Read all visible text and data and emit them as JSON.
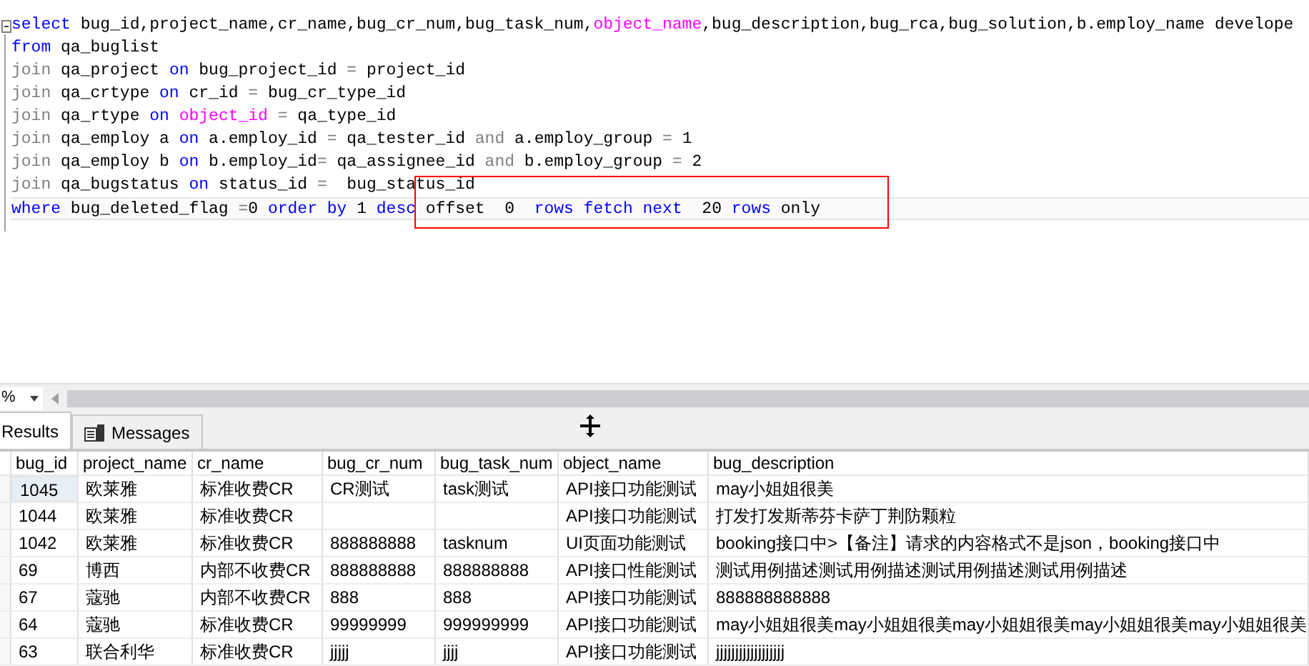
{
  "editor": {
    "lines": [
      {
        "current": false,
        "segments": [
          {
            "kind": "kw",
            "text": "select"
          },
          {
            "kind": "plain",
            "text": " bug_id,project_name,cr_name,bug_cr_num,bug_task_num,"
          },
          {
            "kind": "fn",
            "text": "object_name"
          },
          {
            "kind": "plain",
            "text": ",bug_description,bug_rca,bug_solution,b.employ_name develope"
          }
        ]
      },
      {
        "current": false,
        "segments": [
          {
            "kind": "kw",
            "text": "from"
          },
          {
            "kind": "plain",
            "text": " qa_buglist"
          }
        ]
      },
      {
        "current": false,
        "segments": [
          {
            "kind": "op",
            "text": "join"
          },
          {
            "kind": "plain",
            "text": " qa_project "
          },
          {
            "kind": "kw",
            "text": "on"
          },
          {
            "kind": "plain",
            "text": " bug_project_id "
          },
          {
            "kind": "op",
            "text": "="
          },
          {
            "kind": "plain",
            "text": " project_id"
          }
        ]
      },
      {
        "current": false,
        "segments": [
          {
            "kind": "op",
            "text": "join"
          },
          {
            "kind": "plain",
            "text": " qa_crtype "
          },
          {
            "kind": "kw",
            "text": "on"
          },
          {
            "kind": "plain",
            "text": " cr_id "
          },
          {
            "kind": "op",
            "text": "="
          },
          {
            "kind": "plain",
            "text": " bug_cr_type_id"
          }
        ]
      },
      {
        "current": false,
        "segments": [
          {
            "kind": "op",
            "text": "join"
          },
          {
            "kind": "plain",
            "text": " qa_rtype "
          },
          {
            "kind": "kw",
            "text": "on"
          },
          {
            "kind": "fn",
            "text": " object_id"
          },
          {
            "kind": "op",
            "text": " ="
          },
          {
            "kind": "plain",
            "text": " qa_type_id"
          }
        ]
      },
      {
        "current": false,
        "segments": [
          {
            "kind": "op",
            "text": "join"
          },
          {
            "kind": "plain",
            "text": " qa_employ a "
          },
          {
            "kind": "kw",
            "text": "on"
          },
          {
            "kind": "plain",
            "text": " a.employ_id "
          },
          {
            "kind": "op",
            "text": "="
          },
          {
            "kind": "plain",
            "text": " qa_tester_id "
          },
          {
            "kind": "op",
            "text": "and"
          },
          {
            "kind": "plain",
            "text": " a.employ_group "
          },
          {
            "kind": "op",
            "text": "="
          },
          {
            "kind": "plain",
            "text": " 1"
          }
        ]
      },
      {
        "current": false,
        "segments": [
          {
            "kind": "op",
            "text": "join"
          },
          {
            "kind": "plain",
            "text": " qa_employ b "
          },
          {
            "kind": "kw",
            "text": "on"
          },
          {
            "kind": "plain",
            "text": " b.employ_id"
          },
          {
            "kind": "op",
            "text": "="
          },
          {
            "kind": "plain",
            "text": " qa_assignee_id "
          },
          {
            "kind": "op",
            "text": "and"
          },
          {
            "kind": "plain",
            "text": " b.employ_group "
          },
          {
            "kind": "op",
            "text": "="
          },
          {
            "kind": "plain",
            "text": " 2"
          }
        ]
      },
      {
        "current": false,
        "segments": [
          {
            "kind": "op",
            "text": "join"
          },
          {
            "kind": "plain",
            "text": " qa_bugstatus "
          },
          {
            "kind": "kw",
            "text": "on"
          },
          {
            "kind": "plain",
            "text": " status_id "
          },
          {
            "kind": "op",
            "text": "="
          },
          {
            "kind": "plain",
            "text": "  bug_status_id"
          }
        ]
      },
      {
        "current": true,
        "segments": [
          {
            "kind": "kw",
            "text": "where"
          },
          {
            "kind": "plain",
            "text": " bug_deleted_flag "
          },
          {
            "kind": "op",
            "text": "="
          },
          {
            "kind": "plain",
            "text": "0 "
          },
          {
            "kind": "kw",
            "text": "order by"
          },
          {
            "kind": "plain",
            "text": " 1 "
          },
          {
            "kind": "kw",
            "text": "desc"
          },
          {
            "kind": "plain",
            "text": " offset  0  "
          },
          {
            "kind": "kw",
            "text": "rows fetch next"
          },
          {
            "kind": "plain",
            "text": "  20 "
          },
          {
            "kind": "kw",
            "text": "rows"
          },
          {
            "kind": "plain",
            "text": " only"
          }
        ]
      }
    ]
  },
  "zoom": {
    "value": "%"
  },
  "tabs": [
    {
      "label": "Results",
      "selected": true
    },
    {
      "label": "Messages",
      "selected": false
    }
  ],
  "grid": {
    "columns": [
      "bug_id",
      "project_name",
      "cr_name",
      "bug_cr_num",
      "bug_task_num",
      "object_name",
      "bug_description"
    ],
    "rows": [
      {
        "selected": true,
        "cells": [
          "1045",
          "欧莱雅",
          "标准收费CR",
          "CR测试",
          "task测试",
          "API接口功能测试",
          "may小姐姐很美"
        ]
      },
      {
        "selected": false,
        "cells": [
          "1044",
          "欧莱雅",
          "标准收费CR",
          "",
          "",
          "API接口功能测试",
          "打发打发斯蒂芬卡萨丁荆防颗粒"
        ]
      },
      {
        "selected": false,
        "cells": [
          "1042",
          "欧莱雅",
          "标准收费CR",
          "888888888",
          "tasknum",
          "UI页面功能测试",
          "booking接口中>【备注】请求的内容格式不是json，booking接口中"
        ]
      },
      {
        "selected": false,
        "cells": [
          "69",
          "博西",
          "内部不收费CR",
          "888888888",
          "888888888",
          "API接口性能测试",
          "测试用例描述测试用例描述测试用例描述测试用例描述"
        ]
      },
      {
        "selected": false,
        "cells": [
          "67",
          "蔻驰",
          "内部不收费CR",
          "888",
          "888",
          "API接口功能测试",
          "888888888888"
        ]
      },
      {
        "selected": false,
        "cells": [
          "64",
          "蔻驰",
          "标准收费CR",
          "99999999",
          "999999999",
          "API接口功能测试",
          "may小姐姐很美may小姐姐很美may小姐姐很美may小姐姐很美may小姐姐很美"
        ]
      },
      {
        "selected": false,
        "cells": [
          "63",
          "联合利华",
          "标准收费CR",
          "jjjjj",
          "jjjj",
          "API接口功能测试",
          "jjjjjjjjjjjjjjjjjj"
        ]
      }
    ]
  }
}
